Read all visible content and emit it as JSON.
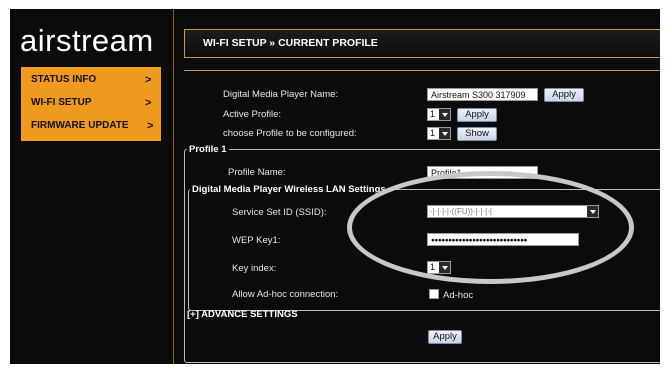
{
  "brand": {
    "logo_text": "airstream"
  },
  "sidebar": {
    "items": [
      {
        "label": "STATUS INFO",
        "chevron": ">"
      },
      {
        "label": "WI-FI SETUP",
        "chevron": ">"
      },
      {
        "label": "FIRMWARE UPDATE",
        "chevron": ">"
      }
    ]
  },
  "header": {
    "title": "WI-FI SETUP » CURRENT PROFILE"
  },
  "main": {
    "player_name_label": "Digital Media Player Name:",
    "player_name_value": "Airstream S300 317909",
    "apply_label": "Apply",
    "active_profile_label": "Active Profile:",
    "active_profile_value": "1",
    "choose_profile_label": "choose Profile to be configured:",
    "choose_profile_value": "1",
    "show_label": "Show",
    "profile_legend": "Profile 1",
    "profile_name_label": "Profile Name:",
    "profile_name_value": "Profile1",
    "wlan_legend": "Digital Media Player Wireless LAN Settings",
    "ssid_label": "Service Set ID (SSID):",
    "ssid_value": "·|·|·|·|·((FU))·|·|·|·|",
    "wep_label": "WEP Key1:",
    "wep_value": "●●●●●●●●●●●●●●●●●●●●●●●●●●●●",
    "key_index_label": "Key index:",
    "key_index_value": "1",
    "adhoc_label": "Allow Ad-hoc connection:",
    "adhoc_option_label": "Ad-hoc",
    "advance_label": "[+] ADVANCE SETTINGS",
    "bottom_apply_label": "Apply"
  },
  "colors": {
    "accent": "#ef9a1e",
    "background": "#0b0b0b",
    "border": "#c89a3a"
  }
}
